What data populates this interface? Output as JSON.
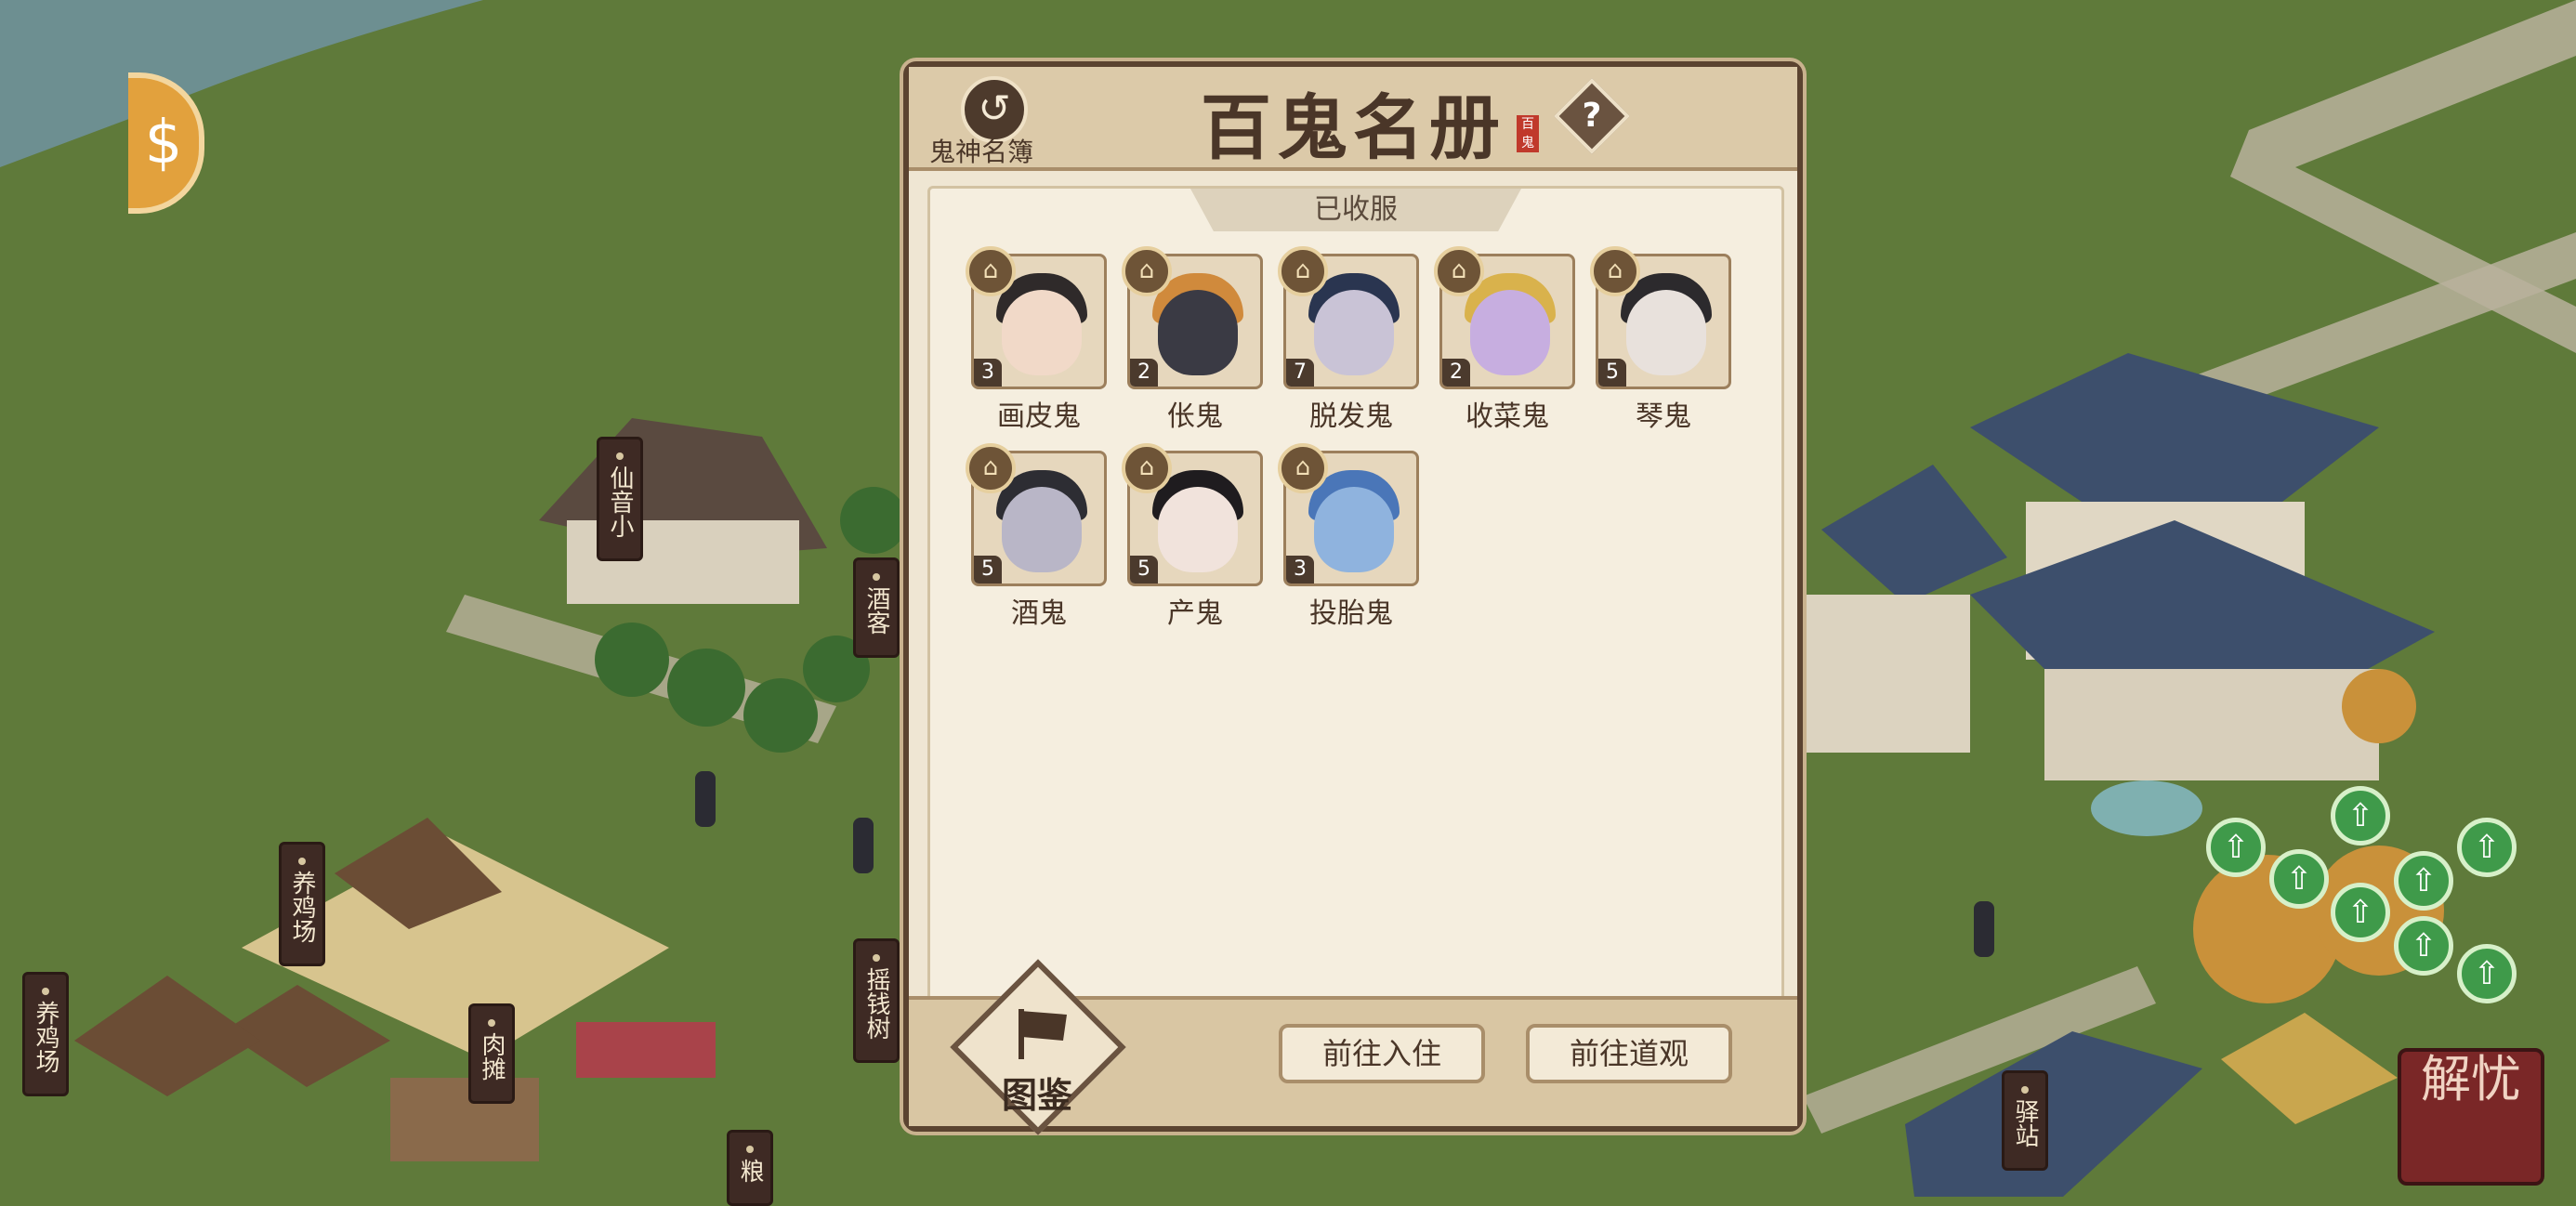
{
  "world": {
    "signs": [
      {
        "text": "仙音小",
        "key": "xianyin"
      },
      {
        "text": "酒客",
        "key": "jiuke"
      },
      {
        "text": "养鸡场",
        "key": "yangjichang1"
      },
      {
        "text": "养鸡场",
        "key": "yangjichang2"
      },
      {
        "text": "肉摊",
        "key": "routan"
      },
      {
        "text": "摇钱树",
        "key": "yaoqianshu"
      },
      {
        "text": "粮",
        "key": "liang"
      },
      {
        "text": "驿站",
        "key": "yizhan"
      }
    ],
    "jieyou_label": "解忧",
    "coin_symbol": "$"
  },
  "panel": {
    "back_icon": "swirl-icon",
    "back_label": "鬼神名簿",
    "title": "百鬼名册",
    "title_stamp": "百鬼",
    "help_symbol": "?",
    "section_tab": "已收服",
    "ghosts": [
      {
        "name": "画皮鬼",
        "level": "3",
        "rank_icon": "temple-icon"
      },
      {
        "name": "伥鬼",
        "level": "2",
        "rank_icon": "temple-icon"
      },
      {
        "name": "脱发鬼",
        "level": "7",
        "rank_icon": "temple-icon"
      },
      {
        "name": "收菜鬼",
        "level": "2",
        "rank_icon": "temple-icon"
      },
      {
        "name": "琴鬼",
        "level": "5",
        "rank_icon": "temple-icon"
      },
      {
        "name": "酒鬼",
        "level": "5",
        "rank_icon": "temple-icon"
      },
      {
        "name": "产鬼",
        "level": "5",
        "rank_icon": "temple-icon"
      },
      {
        "name": "投胎鬼",
        "level": "3",
        "rank_icon": "temple-icon"
      }
    ],
    "footer": {
      "tujian_label": "图鉴",
      "btn_move_in": "前往入住",
      "btn_temple": "前往道观"
    }
  },
  "colors": {
    "panel_border": "#5b4330",
    "panel_bg": "#efe6d3",
    "grass": "#5f7a3a",
    "upgrade_marker": "#3f9a4a"
  }
}
